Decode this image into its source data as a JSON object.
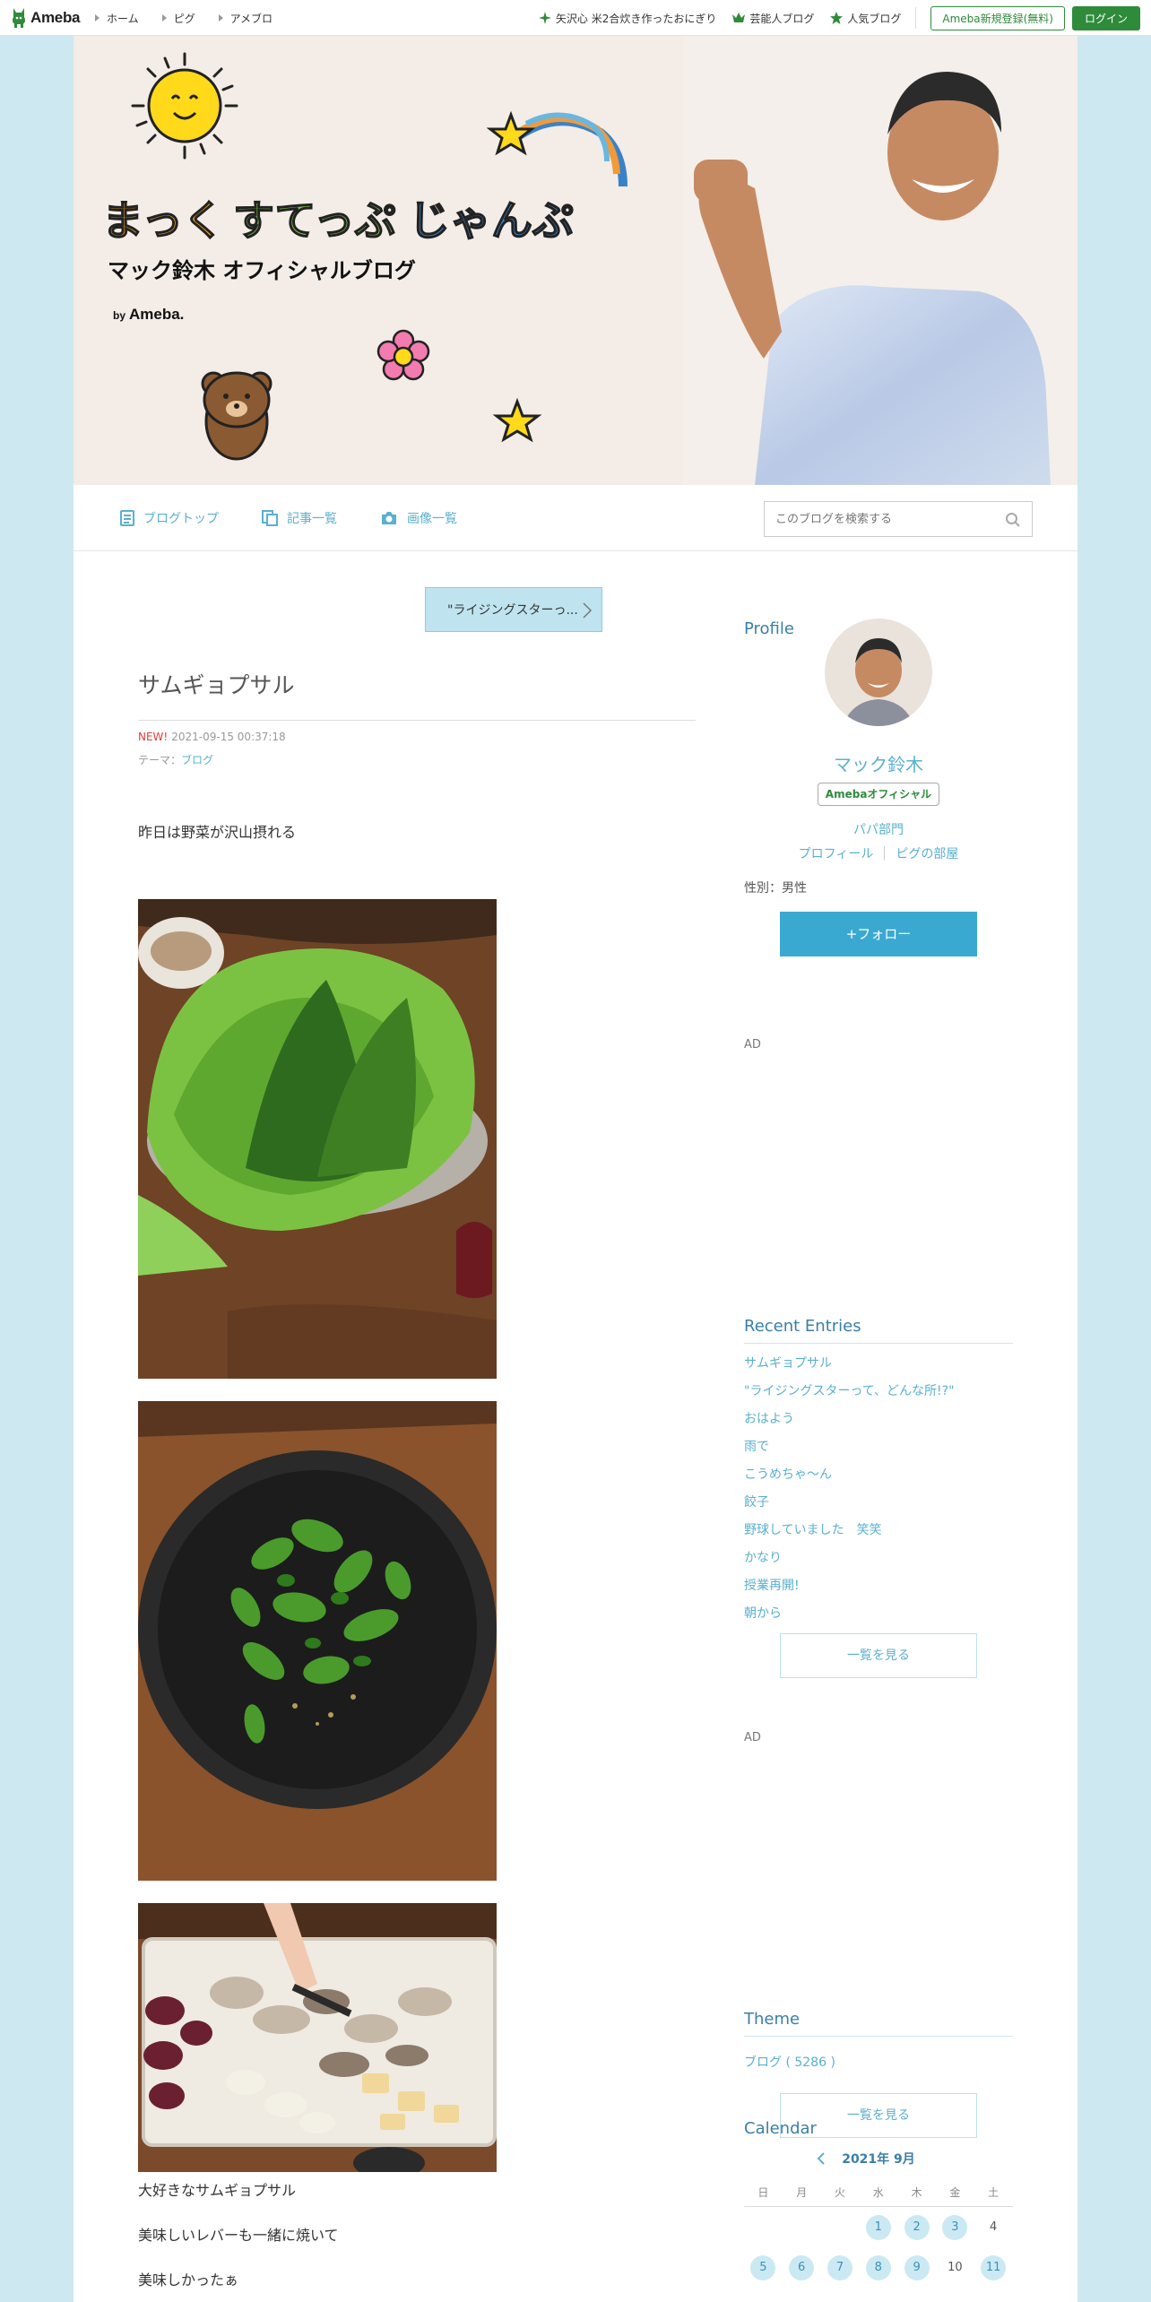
{
  "global_header": {
    "logo": "Ameba",
    "nav": [
      "ホーム",
      "ピグ",
      "アメブロ"
    ],
    "right_links": [
      "矢沢心 米2合炊き作ったおにぎり",
      "芸能人ブログ",
      "人気ブログ"
    ],
    "register_label": "Ameba新規登録(無料)",
    "login_label": "ログイン"
  },
  "banner": {
    "title_part1": "まっく",
    "title_part2": "すてっぷ",
    "title_part3": "じゃんぷ",
    "subtitle": "マック鈴木 オフィシャルブログ",
    "by": "by",
    "by_brand": "Ameba."
  },
  "subnav": {
    "items": [
      "ブログトップ",
      "記事一覧",
      "画像一覧"
    ],
    "search_placeholder": "このブログを検索する"
  },
  "entry": {
    "prev_label": "\"ライジングスターっ...",
    "title": "サムギョプサル",
    "new_label": "NEW!",
    "datetime": "2021-09-15 00:37:18",
    "theme_prefix": "テーマ：",
    "theme": "ブログ",
    "para1": "昨日は野菜が沢山摂れる",
    "para2": "大好きなサムギョプサル",
    "para3": "美味しいレバーも一緒に焼いて",
    "para4": "美味しかったぁ"
  },
  "sidebar": {
    "profile_heading": "Profile",
    "name": "マック鈴木",
    "badge": "Amebaオフィシャル",
    "category": "パパ部門",
    "link_profile": "プロフィール",
    "link_pig": "ピグの部屋",
    "gender": "性別：男性",
    "follow_label": "+フォロー",
    "ad_label": "AD",
    "recent_heading": "Recent Entries",
    "recent_entries": [
      "サムギョプサル",
      "\"ライジングスターって、どんな所!?\"",
      "おはよう",
      "雨で",
      "こうめちゃ〜ん",
      "餃子",
      "野球していました　笑笑",
      "かなり",
      "授業再開!",
      "朝から"
    ],
    "more_label": "一覧を見る",
    "theme_heading": "Theme",
    "theme_item": "ブログ ( 5286 )",
    "calendar_heading": "Calendar",
    "calendar_month": "2021年 9月",
    "weekdays": [
      "日",
      "月",
      "火",
      "水",
      "木",
      "金",
      "土"
    ],
    "week1": [
      "",
      "",
      "",
      "1",
      "2",
      "3",
      "4"
    ],
    "week2": [
      "5",
      "6",
      "7",
      "8",
      "9",
      "10",
      "11"
    ]
  },
  "colors": {
    "ameba_green": "#2e8b3a",
    "link_blue": "#5ab0cf",
    "heading_blue": "#3a7fa8",
    "page_bg": "#cde8f0",
    "follow_button": "#3aa9d1"
  }
}
